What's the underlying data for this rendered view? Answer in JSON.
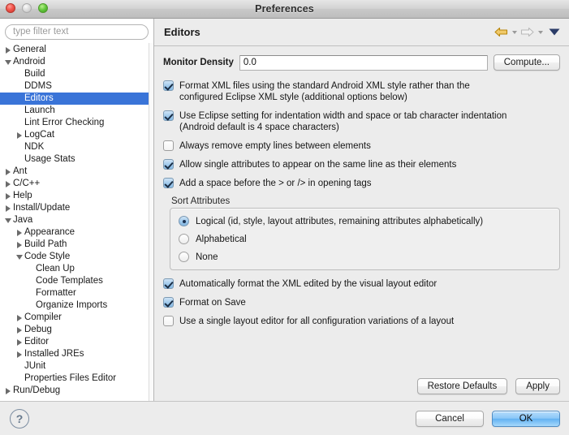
{
  "window": {
    "title": "Preferences",
    "controls": {
      "close": "close-button",
      "minimize": "minimize-button",
      "zoom": "zoom-button"
    }
  },
  "sidebar": {
    "filter": {
      "placeholder": "type filter text",
      "value": ""
    },
    "items": [
      {
        "label": "General",
        "depth": 0,
        "twisty": "closed",
        "selected": false
      },
      {
        "label": "Android",
        "depth": 0,
        "twisty": "open",
        "selected": false
      },
      {
        "label": "Build",
        "depth": 1,
        "twisty": "none",
        "selected": false
      },
      {
        "label": "DDMS",
        "depth": 1,
        "twisty": "none",
        "selected": false
      },
      {
        "label": "Editors",
        "depth": 1,
        "twisty": "none",
        "selected": true
      },
      {
        "label": "Launch",
        "depth": 1,
        "twisty": "none",
        "selected": false
      },
      {
        "label": "Lint Error Checking",
        "depth": 1,
        "twisty": "none",
        "selected": false
      },
      {
        "label": "LogCat",
        "depth": 1,
        "twisty": "closed",
        "selected": false
      },
      {
        "label": "NDK",
        "depth": 1,
        "twisty": "none",
        "selected": false
      },
      {
        "label": "Usage Stats",
        "depth": 1,
        "twisty": "none",
        "selected": false
      },
      {
        "label": "Ant",
        "depth": 0,
        "twisty": "closed",
        "selected": false
      },
      {
        "label": "C/C++",
        "depth": 0,
        "twisty": "closed",
        "selected": false
      },
      {
        "label": "Help",
        "depth": 0,
        "twisty": "closed",
        "selected": false
      },
      {
        "label": "Install/Update",
        "depth": 0,
        "twisty": "closed",
        "selected": false
      },
      {
        "label": "Java",
        "depth": 0,
        "twisty": "open",
        "selected": false
      },
      {
        "label": "Appearance",
        "depth": 1,
        "twisty": "closed",
        "selected": false
      },
      {
        "label": "Build Path",
        "depth": 1,
        "twisty": "closed",
        "selected": false
      },
      {
        "label": "Code Style",
        "depth": 1,
        "twisty": "open",
        "selected": false
      },
      {
        "label": "Clean Up",
        "depth": 2,
        "twisty": "none",
        "selected": false
      },
      {
        "label": "Code Templates",
        "depth": 2,
        "twisty": "none",
        "selected": false
      },
      {
        "label": "Formatter",
        "depth": 2,
        "twisty": "none",
        "selected": false
      },
      {
        "label": "Organize Imports",
        "depth": 2,
        "twisty": "none",
        "selected": false
      },
      {
        "label": "Compiler",
        "depth": 1,
        "twisty": "closed",
        "selected": false
      },
      {
        "label": "Debug",
        "depth": 1,
        "twisty": "closed",
        "selected": false
      },
      {
        "label": "Editor",
        "depth": 1,
        "twisty": "closed",
        "selected": false
      },
      {
        "label": "Installed JREs",
        "depth": 1,
        "twisty": "closed",
        "selected": false
      },
      {
        "label": "JUnit",
        "depth": 1,
        "twisty": "none",
        "selected": false
      },
      {
        "label": "Properties Files Editor",
        "depth": 1,
        "twisty": "none",
        "selected": false
      },
      {
        "label": "Run/Debug",
        "depth": 0,
        "twisty": "closed",
        "selected": false
      }
    ]
  },
  "page": {
    "title": "Editors",
    "toolbar": {
      "back": "back-arrow-icon",
      "back_menu": "back-dropdown-icon",
      "forward": "forward-arrow-icon",
      "forward_menu": "forward-dropdown-icon",
      "view_menu": "view-menu-icon"
    },
    "density": {
      "label": "Monitor Density",
      "value": "0.0",
      "placeholder": "",
      "compute_label": "Compute..."
    },
    "checkboxes_top": [
      {
        "line1": "Format XML files using the standard Android XML style rather than the",
        "line2": "configured Eclipse XML style (additional options below)",
        "checked": true
      },
      {
        "line1": "Use Eclipse setting for indentation width and space or tab character indentation",
        "line2": "(Android default is 4 space characters)",
        "checked": true
      },
      {
        "line1": "Always remove empty lines between elements",
        "line2": "",
        "checked": false
      },
      {
        "line1": "Allow single attributes to appear on the same line as their elements",
        "line2": "",
        "checked": true
      },
      {
        "line1": "Add a space before the > or /> in opening tags",
        "line2": "",
        "checked": true
      }
    ],
    "sort_group": {
      "label": "Sort Attributes",
      "options": [
        {
          "label": "Logical (id, style, layout attributes, remaining attributes alphabetically)",
          "selected": true
        },
        {
          "label": "Alphabetical",
          "selected": false
        },
        {
          "label": "None",
          "selected": false
        }
      ]
    },
    "checkboxes_bottom": [
      {
        "line1": "Automatically format the XML edited by the visual layout editor",
        "line2": "",
        "checked": true
      },
      {
        "line1": "Format on Save",
        "line2": "",
        "checked": true
      },
      {
        "line1": "Use a single layout editor for all configuration variations of a layout",
        "line2": "",
        "checked": false
      }
    ],
    "actions": {
      "restore_defaults": "Restore Defaults",
      "apply": "Apply"
    }
  },
  "footer": {
    "help": "?",
    "cancel": "Cancel",
    "ok": "OK"
  },
  "colors": {
    "selection_blue": "#3a74d8",
    "default_button_blue": "#8cc8f8",
    "back_arrow_orange": "#d9a23a",
    "window_bg": "#ececec"
  }
}
